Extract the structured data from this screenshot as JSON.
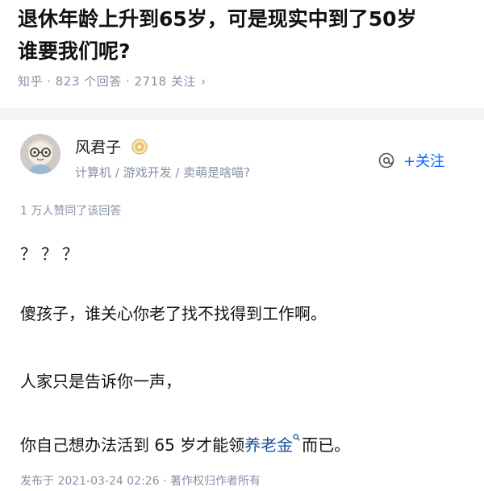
{
  "question": {
    "title_line1": "退休年龄上升到65岁，可是现实中到了50岁",
    "title_line2": "谁要我们呢?",
    "meta": "知乎 · 823 个回答 · 2718 关注",
    "meta_chevron": "›"
  },
  "author": {
    "name": "风君子",
    "bio": "计算机 / 游戏开发 / 卖萌是啥喵?",
    "follow_label": "+关注",
    "badge_icon": "gold-badge-icon",
    "avatar_icon": "cartoon-avatar-with-glasses"
  },
  "answer": {
    "upvotes_text": "1 万人赞同了该回答",
    "paragraph1": "？？？",
    "paragraph2": "傻孩子，谁关心你老了找不找得到工作啊。",
    "paragraph3": "人家只是告诉你一声，",
    "paragraph4_before": "你自己想办法活到 65 岁才能领",
    "paragraph4_link": "养老金",
    "paragraph4_after": "而已。",
    "footer": "发布于 2021-03-24 02:26 · 著作权归作者所有"
  },
  "colors": {
    "link_blue": "#175199",
    "follow_blue": "#0066ff",
    "meta_gray": "#8590a6"
  }
}
